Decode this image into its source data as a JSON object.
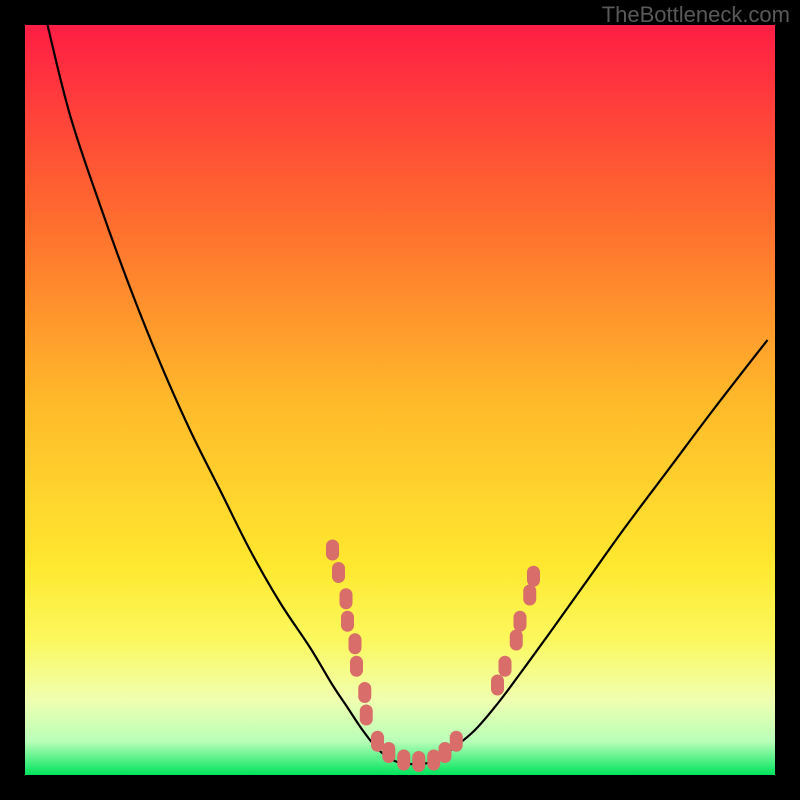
{
  "watermark": "TheBottleneck.com",
  "chart_data": {
    "type": "line",
    "title": "",
    "xlabel": "",
    "ylabel": "",
    "xlim": [
      0,
      100
    ],
    "ylim": [
      0,
      100
    ],
    "background_gradient": {
      "stops": [
        {
          "offset": 0.0,
          "color": "#ff1d44"
        },
        {
          "offset": 0.25,
          "color": "#ff6a2f"
        },
        {
          "offset": 0.5,
          "color": "#ffb92a"
        },
        {
          "offset": 0.72,
          "color": "#ffe82f"
        },
        {
          "offset": 0.82,
          "color": "#fbf85e"
        },
        {
          "offset": 0.9,
          "color": "#f0ffb0"
        },
        {
          "offset": 0.955,
          "color": "#b9ffb8"
        },
        {
          "offset": 1.0,
          "color": "#00e45d"
        }
      ]
    },
    "green_band": {
      "y_top": 96,
      "y_bottom": 100
    },
    "pale_band": {
      "y_top": 80,
      "y_bottom": 96
    },
    "curve": {
      "description": "Asymmetric V-shaped bottleneck curve. Steep descent from top-left, minimum near x≈48-55 at y≈98, shallower rise to upper right.",
      "x": [
        3,
        6,
        10,
        14,
        18,
        22,
        26,
        30,
        34,
        38,
        41,
        43,
        45,
        47,
        49,
        51,
        53,
        55,
        57,
        60,
        63,
        66,
        70,
        75,
        80,
        86,
        92,
        99
      ],
      "y": [
        0,
        12,
        24,
        35,
        45,
        54,
        62,
        70,
        77,
        83,
        88,
        91,
        94,
        96.5,
        98,
        98.5,
        98.5,
        98,
        96.5,
        94,
        90.5,
        86.5,
        81,
        74,
        67,
        59,
        51,
        42
      ]
    },
    "dots": {
      "description": "Salmon-colored rounded markers clustered near the valley on both arms of the curve.",
      "color": "#d86d6a",
      "points": [
        {
          "x": 41.0,
          "y": 70.0
        },
        {
          "x": 41.8,
          "y": 73.0
        },
        {
          "x": 42.8,
          "y": 76.5
        },
        {
          "x": 43.0,
          "y": 79.5
        },
        {
          "x": 44.0,
          "y": 82.5
        },
        {
          "x": 44.2,
          "y": 85.5
        },
        {
          "x": 45.3,
          "y": 89.0
        },
        {
          "x": 45.5,
          "y": 92.0
        },
        {
          "x": 47.0,
          "y": 95.5
        },
        {
          "x": 48.5,
          "y": 97.0
        },
        {
          "x": 50.5,
          "y": 98.0
        },
        {
          "x": 52.5,
          "y": 98.2
        },
        {
          "x": 54.5,
          "y": 98.0
        },
        {
          "x": 56.0,
          "y": 97.0
        },
        {
          "x": 57.5,
          "y": 95.5
        },
        {
          "x": 63.0,
          "y": 88.0
        },
        {
          "x": 64.0,
          "y": 85.5
        },
        {
          "x": 65.5,
          "y": 82.0
        },
        {
          "x": 66.0,
          "y": 79.5
        },
        {
          "x": 67.3,
          "y": 76.0
        },
        {
          "x": 67.8,
          "y": 73.5
        }
      ]
    }
  }
}
